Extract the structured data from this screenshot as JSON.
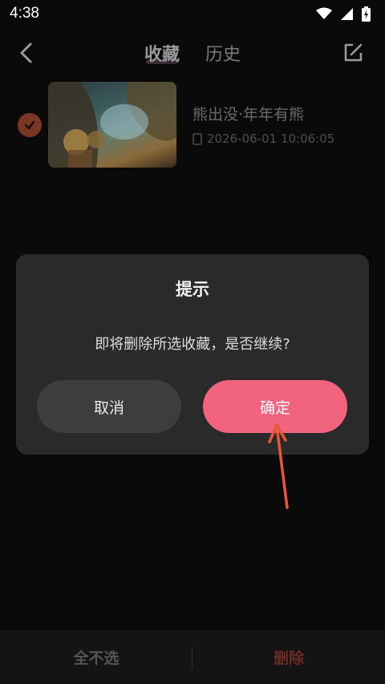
{
  "status_bar": {
    "time": "4:38"
  },
  "header": {
    "tabs": [
      {
        "label": "收藏",
        "active": true
      },
      {
        "label": "历史",
        "active": false
      }
    ]
  },
  "list": {
    "items": [
      {
        "title": "熊出没·年年有熊",
        "timestamp": "2026-06-01 10:06:05",
        "selected": true
      }
    ]
  },
  "dialog": {
    "title": "提示",
    "message": "即将删除所选收藏，是否继续?",
    "cancel_label": "取消",
    "confirm_label": "确定"
  },
  "bottom_bar": {
    "select_none_label": "全不选",
    "delete_label": "删除"
  },
  "colors": {
    "accent": "#f2637e",
    "annotation_arrow": "#e8553b",
    "selected_check": "#7a3524"
  }
}
